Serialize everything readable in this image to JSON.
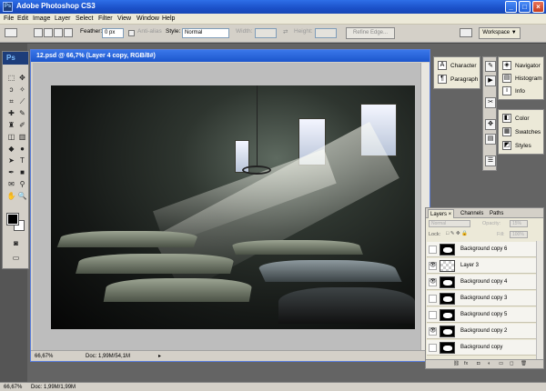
{
  "app": {
    "title": "Adobe Photoshop CS3",
    "logo": "Ps"
  },
  "window_controls": {
    "minimize": "_",
    "maximize": "□",
    "close": "×"
  },
  "menu": [
    "File",
    "Edit",
    "Image",
    "Layer",
    "Select",
    "Filter",
    "View",
    "Window",
    "Help"
  ],
  "options": {
    "feather_label": "Feather:",
    "feather_value": "0 px",
    "antialias_label": "Anti-alias",
    "style_label": "Style:",
    "style_value": "Normal",
    "width_label": "Width:",
    "height_label": "Height:",
    "refine_edge_label": "Refine Edge...",
    "workspace_label": "Workspace ▼"
  },
  "document": {
    "title": "12.psd @ 66,7% (Layer 4 copy, RGB/8#)",
    "zoom": "66,67%",
    "doc_info": "Doc: 1,99M/54,1M"
  },
  "panels": {
    "text_dock": [
      {
        "label": "Character",
        "icon": "character-icon",
        "glyph": "A"
      },
      {
        "label": "Paragraph",
        "icon": "paragraph-icon",
        "glyph": "¶"
      }
    ],
    "info_dock": [
      {
        "label": "Navigator",
        "icon": "navigator-icon",
        "glyph": "◈"
      },
      {
        "label": "Histogram",
        "icon": "histogram-icon",
        "glyph": "▤"
      },
      {
        "label": "Info",
        "icon": "info-icon",
        "glyph": "i"
      }
    ],
    "color_dock": [
      {
        "label": "Color",
        "icon": "color-icon",
        "glyph": "◧"
      },
      {
        "label": "Swatches",
        "icon": "swatches-icon",
        "glyph": "▦"
      },
      {
        "label": "Styles",
        "icon": "styles-icon",
        "glyph": "◩"
      }
    ]
  },
  "layers_panel": {
    "tabs": [
      "Layers ×",
      "Channels",
      "Paths"
    ],
    "blend_mode": "Normal",
    "opacity_label": "Opacity:",
    "opacity_value": "15%",
    "lock_label": "Lock:",
    "fill_label": "Fill:",
    "fill_value": "100%",
    "layers": [
      {
        "name": "Background copy 6",
        "visible": false,
        "thumb": "mask"
      },
      {
        "name": "Layer 3",
        "visible": true,
        "thumb": "transparent"
      },
      {
        "name": "Background copy 4",
        "visible": true,
        "thumb": "mask"
      },
      {
        "name": "Background copy 3",
        "visible": false,
        "thumb": "mask"
      },
      {
        "name": "Background copy 5",
        "visible": false,
        "thumb": "mask"
      },
      {
        "name": "Background copy 2",
        "visible": true,
        "thumb": "mask"
      },
      {
        "name": "Background copy",
        "visible": false,
        "thumb": "mask"
      }
    ]
  },
  "status": {
    "zoom": "66,67%",
    "doc_info": "Doc: 1,99M/1,99M"
  }
}
